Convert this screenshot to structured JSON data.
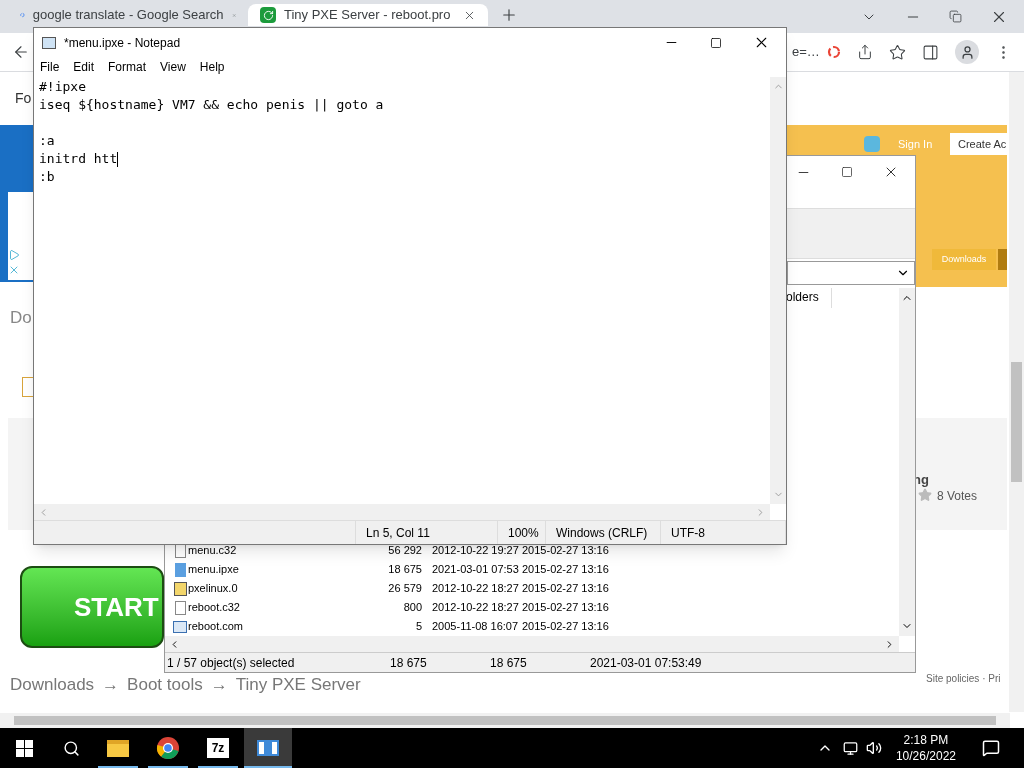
{
  "browser": {
    "tabs": [
      {
        "title": "google translate - Google Search",
        "kind": "google",
        "selected": false
      },
      {
        "title": "Tiny PXE Server - reboot.pro",
        "kind": "site",
        "selected": true
      }
    ],
    "address_fragment": "e=…",
    "page": {
      "nav_fragment": "Fo",
      "heading_fragment": "Do",
      "sign_in": "Sign In",
      "create_account": "Create Ac",
      "downloads_button": "Downloads",
      "rating_fragment": "ng",
      "votes": "8 Votes",
      "start_button": "START",
      "breadcrumbs": [
        "Downloads",
        "Boot tools",
        "Tiny PXE Server"
      ],
      "breadcrumb_separator": "→",
      "footer": "Site policies · Pri"
    }
  },
  "archive_window": {
    "column_fragment": "olders",
    "files": [
      {
        "name": "menu.c32",
        "kind": "blank",
        "size": "56 292",
        "modified": "2012-10-22 19:27",
        "created": "2015-02-27 13:16"
      },
      {
        "name": "menu.ipxe",
        "kind": "script",
        "size": "18 675",
        "modified": "2021-03-01 07:53",
        "created": "2015-02-27 13:16"
      },
      {
        "name": "pxelinux.0",
        "kind": "binary",
        "size": "26 579",
        "modified": "2012-10-22 18:27",
        "created": "2015-02-27 13:16"
      },
      {
        "name": "reboot.c32",
        "kind": "blank",
        "size": "800",
        "modified": "2012-10-22 18:27",
        "created": "2015-02-27 13:16"
      },
      {
        "name": "reboot.com",
        "kind": "app",
        "size": "5",
        "modified": "2005-11-08 16:07",
        "created": "2015-02-27 13:16"
      }
    ],
    "status_bar": [
      "1 / 57 object(s) selected",
      "18 675",
      "18 675",
      "2021-03-01 07:53:49"
    ]
  },
  "notepad": {
    "title": "*menu.ipxe - Notepad",
    "menu": [
      "File",
      "Edit",
      "Format",
      "View",
      "Help"
    ],
    "lines": [
      {
        "text": "#!ipxe"
      },
      {
        "text": "iseq ${hostname} VM7 && echo penis || goto a"
      },
      {
        "text": ":a",
        "blank_line_before": true
      },
      {
        "text": "initrd htt",
        "cursor": true
      },
      {
        "text": ":b"
      }
    ],
    "status_bar": [
      "Ln 5, Col 11",
      "100%",
      "Windows (CRLF)",
      "UTF-8"
    ]
  },
  "taskbar": {
    "apps": [
      {
        "kind": "explorer",
        "active": false
      },
      {
        "kind": "chrome",
        "active": false
      },
      {
        "kind": "sevenzip",
        "label": "7z",
        "active": false
      },
      {
        "kind": "notepad",
        "active": true
      }
    ],
    "time": "2:18 PM",
    "date": "10/26/2022"
  }
}
